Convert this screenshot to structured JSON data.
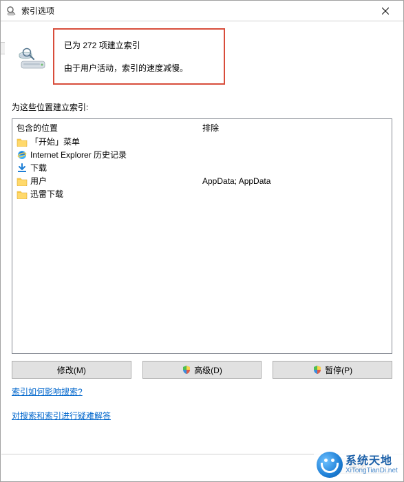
{
  "titlebar": {
    "title": "索引选项"
  },
  "status": {
    "line1": "已为 272 项建立索引",
    "line2": "由于用户活动，索引的速度减慢。"
  },
  "section_label": "为这些位置建立索引:",
  "columns": {
    "included": "包含的位置",
    "excluded": "排除"
  },
  "locations": [
    {
      "icon": "folder",
      "label": "「开始」菜单",
      "excluded": ""
    },
    {
      "icon": "ie",
      "label": "Internet Explorer 历史记录",
      "excluded": ""
    },
    {
      "icon": "download",
      "label": "下载",
      "excluded": ""
    },
    {
      "icon": "folder",
      "label": "用户",
      "excluded": "AppData; AppData"
    },
    {
      "icon": "folder",
      "label": "迅雷下载",
      "excluded": ""
    }
  ],
  "buttons": {
    "modify": "修改(M)",
    "advanced": "高级(D)",
    "pause": "暂停(P)"
  },
  "links": {
    "how_affects": "索引如何影响搜索?",
    "troubleshoot": "对搜索和索引进行疑难解答"
  },
  "close_button": "关闭",
  "watermark": {
    "line1": "系统天地",
    "line2": "XiTongTianDi.net"
  }
}
